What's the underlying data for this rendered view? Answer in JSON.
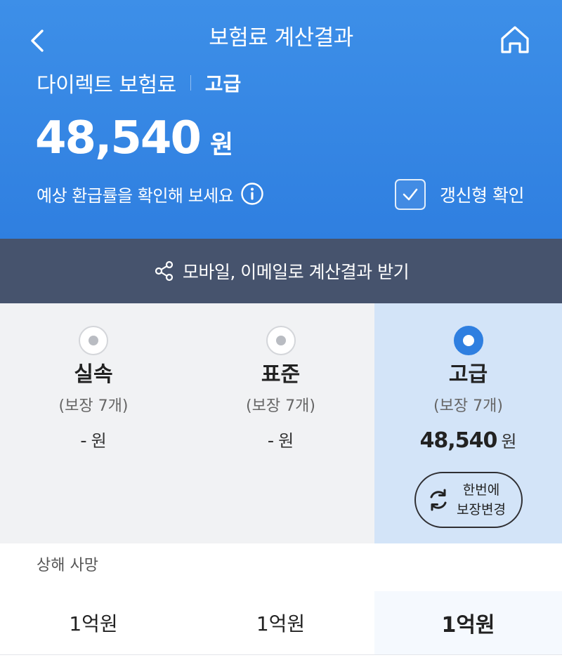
{
  "header": {
    "title": "보험료 계산결과",
    "product_name": "다이렉트 보험료",
    "grade": "고급",
    "premium_amount": "48,540",
    "premium_unit": "원",
    "refund_text": "예상 환급률을 확인해 보세요",
    "renew_label": "갱신형 확인",
    "renew_checked": true
  },
  "share": {
    "label": "모바일, 이메일로 계산결과 받기"
  },
  "plans": [
    {
      "name": "실속",
      "coverage": "(보장 7개)",
      "amount": "-",
      "unit": "원",
      "selected": false
    },
    {
      "name": "표준",
      "coverage": "(보장 7개)",
      "amount": "-",
      "unit": "원",
      "selected": false
    },
    {
      "name": "고급",
      "coverage": "(보장 7개)",
      "amount": "48,540",
      "unit": "원",
      "selected": true
    }
  ],
  "change_button": {
    "line1": "한번에",
    "line2": "보장변경"
  },
  "coverage": {
    "title": "상해 사망",
    "values": [
      "1억원",
      "1억원",
      "1억원"
    ]
  },
  "colors": {
    "header_bg": "#2f7fe0",
    "share_bg": "#46536d",
    "plans_bg": "#f1f2f4",
    "selected_plan_bg": "#d3e4f8",
    "accent": "#2f7fe0"
  },
  "icons": {
    "back": "chevron-left-icon",
    "home": "home-icon",
    "info": "info-icon",
    "check": "check-icon",
    "share": "share-icon",
    "change": "refresh-icon"
  }
}
